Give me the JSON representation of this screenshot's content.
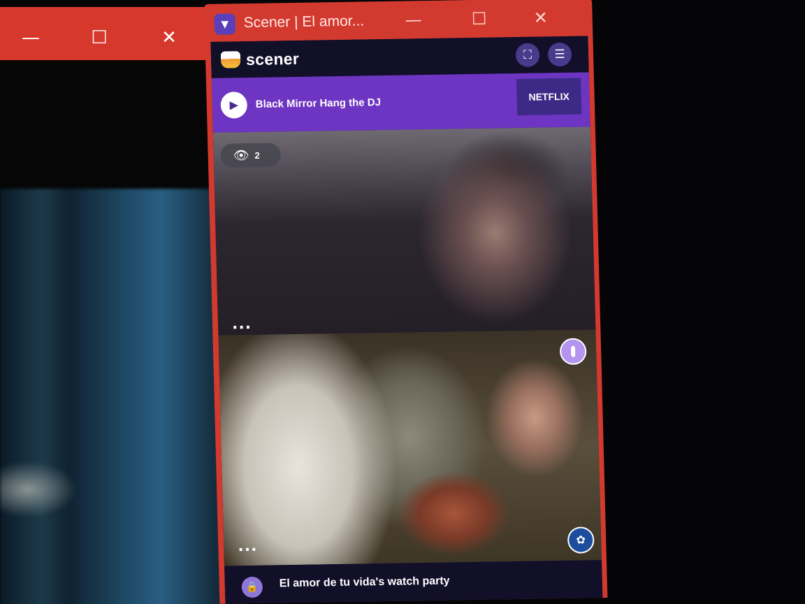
{
  "background_window": {
    "controls": {
      "minimize": "—",
      "maximize": "☐",
      "close": "✕"
    }
  },
  "scener_window": {
    "title": "Scener | El amor...",
    "controls": {
      "minimize": "—",
      "maximize": "☐",
      "close": "✕"
    },
    "header": {
      "logo_text": "scener",
      "fullscreen_icon": "fullscreen-icon",
      "menu_icon": "hamburger-menu-icon"
    },
    "now_playing": {
      "title": "Black Mirror Hang the DJ",
      "service": "NETFLIX"
    },
    "tiles": [
      {
        "viewers": "2",
        "more": "..."
      },
      {
        "more": "..."
      }
    ],
    "party_bar": {
      "title": "El amor de tu vida's watch party"
    }
  },
  "colors": {
    "titlebar_red": "#d33a2f",
    "scener_purple": "#6d35c2",
    "scener_dark": "#120f29"
  }
}
